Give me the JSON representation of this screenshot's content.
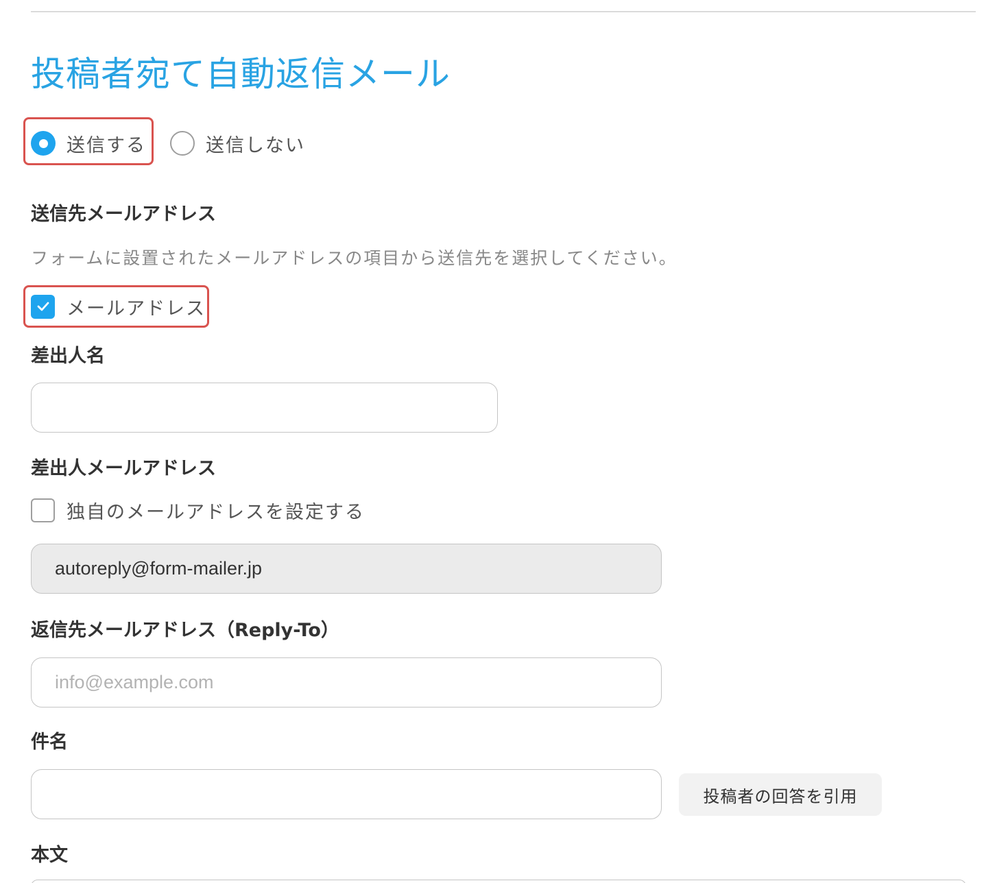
{
  "title": "投稿者宛て自動返信メール",
  "send_options": {
    "send_label": "送信する",
    "no_send_label": "送信しない",
    "selected": "送信する"
  },
  "recipient": {
    "label": "送信先メールアドレス",
    "description": "フォームに設置されたメールアドレスの項目から送信先を選択してください。",
    "field_label": "メールアドレス",
    "checked": true
  },
  "sender_name": {
    "label": "差出人名",
    "value": ""
  },
  "sender_email": {
    "label": "差出人メールアドレス",
    "custom_label": "独自のメールアドレスを設定する",
    "custom_checked": false,
    "value": "autoreply@form-mailer.jp"
  },
  "reply_to": {
    "label": "返信先メールアドレス（Reply-To）",
    "placeholder": "info@example.com",
    "value": ""
  },
  "subject": {
    "label": "件名",
    "value": "",
    "quote_button": "投稿者の回答を引用"
  },
  "body": {
    "label": "本文"
  },
  "colors": {
    "accent": "#1ea4ee",
    "title": "#29a3e3",
    "highlight": "#d9534f"
  }
}
